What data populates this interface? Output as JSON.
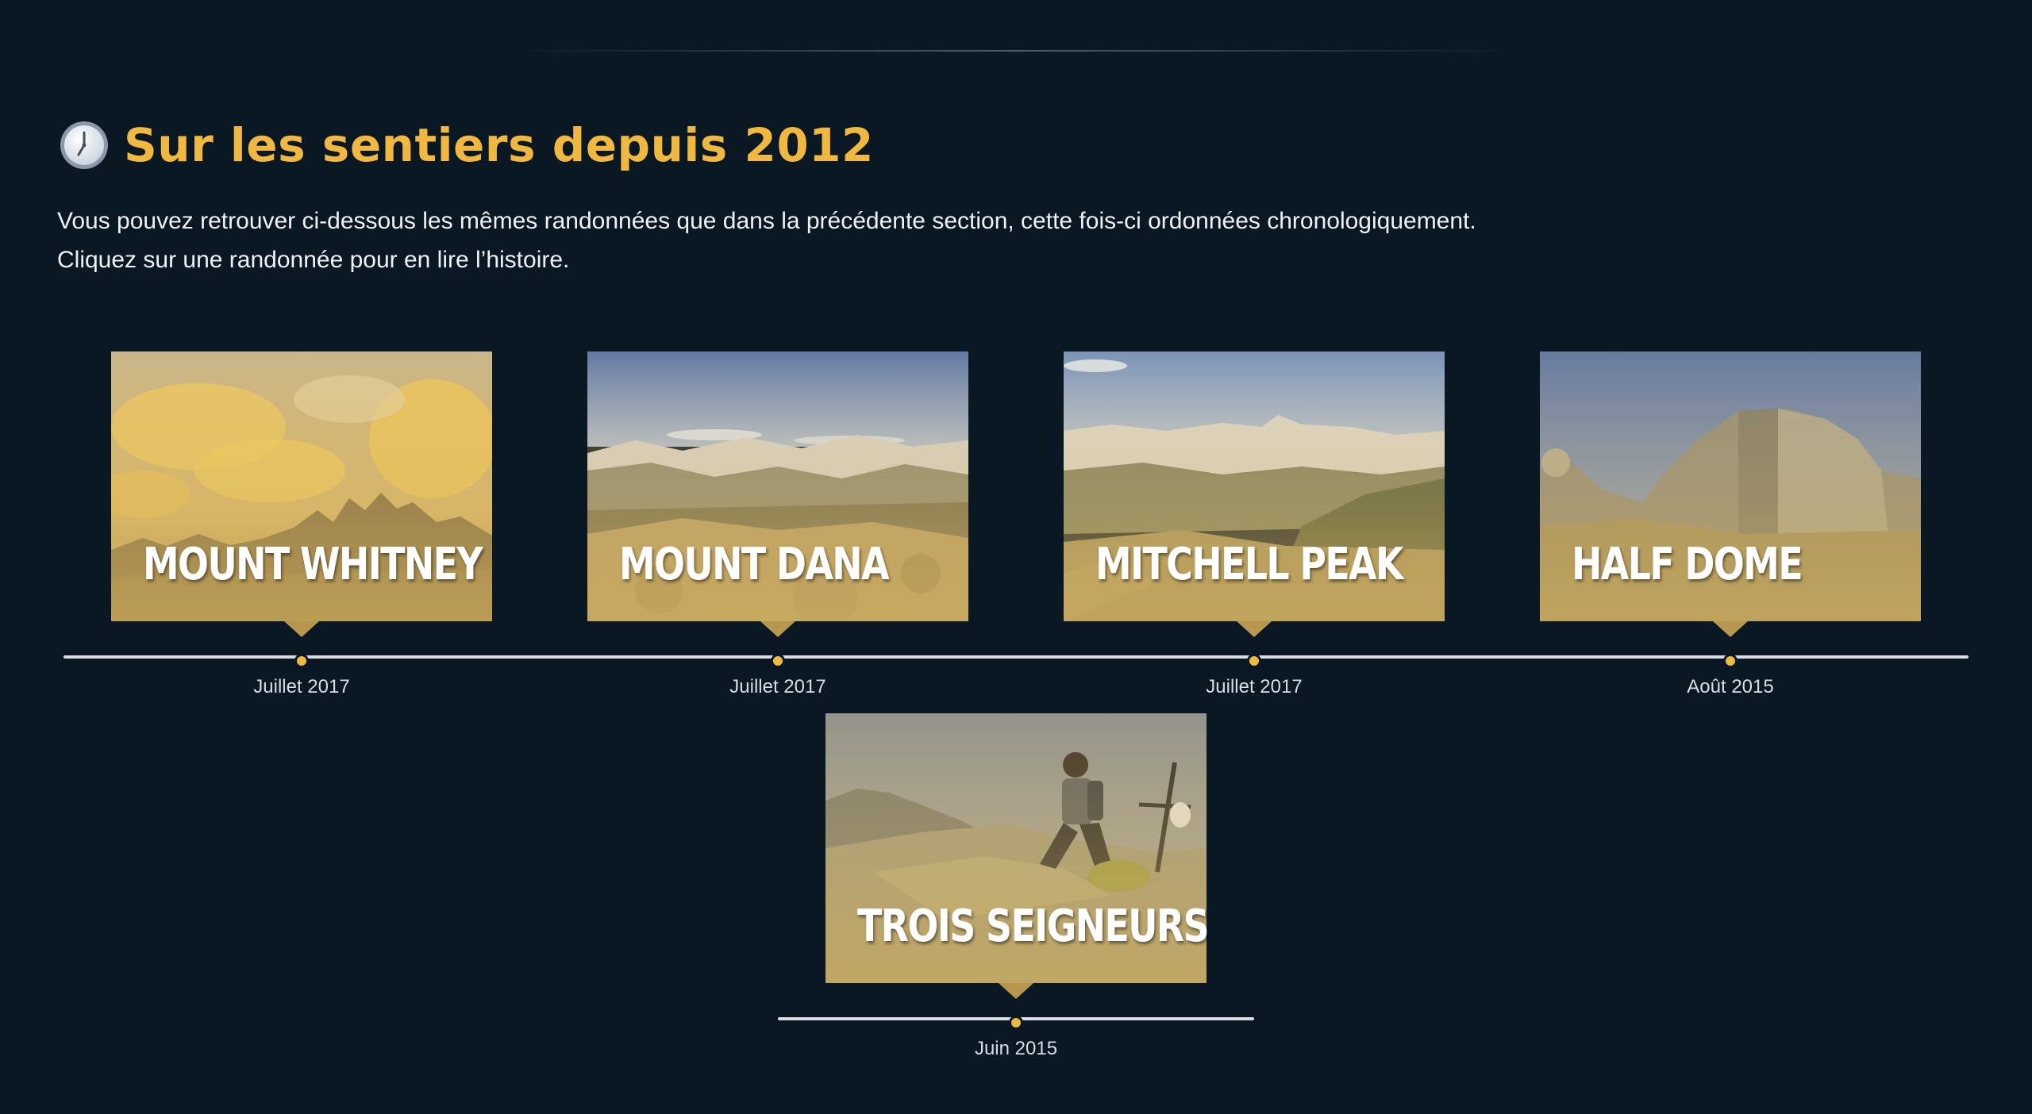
{
  "section": {
    "title": "Sur les sentiers depuis 2012",
    "icon": "clock-icon",
    "intro_line1": "Vous pouvez retrouver ci-dessous les mêmes randonnées que dans la précédente section, cette fois-ci ordonnées chronologiquement.",
    "intro_line2": "Cliquez sur une randonnée pour en lire l’histoire."
  },
  "colors": {
    "background": "#0a1824",
    "accent": "#f0b83e",
    "text": "#eef2f6",
    "timeline": "#d9dde2"
  },
  "timeline": {
    "rows": [
      {
        "hikes": [
          {
            "name": "MOUNT WHITNEY",
            "date": "Juillet 2017",
            "photo": "sunset-cloud-peaks"
          },
          {
            "name": "MOUNT DANA",
            "date": "Juillet 2017",
            "photo": "summit-panorama"
          },
          {
            "name": "MITCHELL PEAK",
            "date": "Juillet 2017",
            "photo": "forest-valley-panorama"
          },
          {
            "name": "HALF DOME",
            "date": "Août 2015",
            "photo": "granite-dome"
          }
        ]
      },
      {
        "hikes": [
          {
            "name": "TROIS SEIGNEURS",
            "date": "Juin 2015",
            "photo": "hiker-on-summit"
          }
        ]
      }
    ]
  }
}
